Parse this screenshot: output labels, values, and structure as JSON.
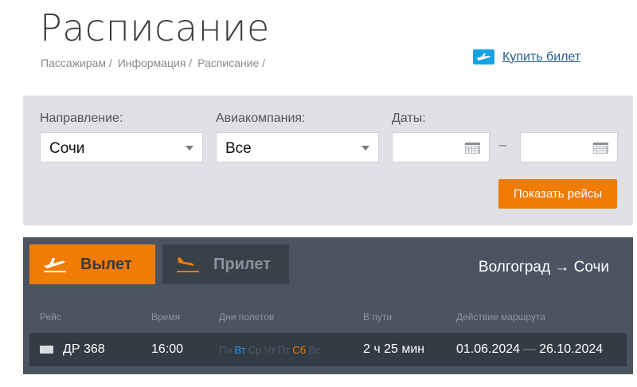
{
  "page": {
    "title": "Расписание"
  },
  "breadcrumb": [
    "Пассажирам /",
    "Информация /",
    "Расписание /"
  ],
  "buy_ticket": {
    "label": "Купить билет",
    "icon": "ticket-icon"
  },
  "filter": {
    "direction_label": "Направление:",
    "direction_value": "Сочи",
    "airline_label": "Авиакомпания:",
    "airline_value": "Все",
    "dates_label": "Даты:",
    "date_separator": "–",
    "show_button": "Показать рейсы"
  },
  "tabs": [
    {
      "label": "Вылет",
      "icon": "plane-departure-icon",
      "active": true
    },
    {
      "label": "Прилет",
      "icon": "plane-arrival-icon",
      "active": false
    }
  ],
  "route": "Волгоград → Сочи",
  "table": {
    "headers": [
      "Рейс",
      "Время",
      "Дни полетов",
      "В пути",
      "Действие маршрута"
    ],
    "rows": [
      {
        "flight": "ДР 368",
        "time": "16:00",
        "days": [
          {
            "d": "Пн",
            "active": false
          },
          {
            "d": "Вт",
            "active": true,
            "color": "#2196f3"
          },
          {
            "d": "Ср",
            "active": false
          },
          {
            "d": "Чт",
            "active": false
          },
          {
            "d": "Пт",
            "active": false
          },
          {
            "d": "Сб",
            "active": true,
            "color": "#f07c06"
          },
          {
            "d": "Вс",
            "active": false
          }
        ],
        "duration": "2 ч 25 мин",
        "valid_from": "01.06.2024",
        "valid_sep": "—",
        "valid_to": "26.10.2024"
      }
    ]
  },
  "colors": {
    "accent": "#f07c06",
    "dark": "#4a5561",
    "link": "#2a5d8f",
    "ticket": "#17a3e3"
  }
}
